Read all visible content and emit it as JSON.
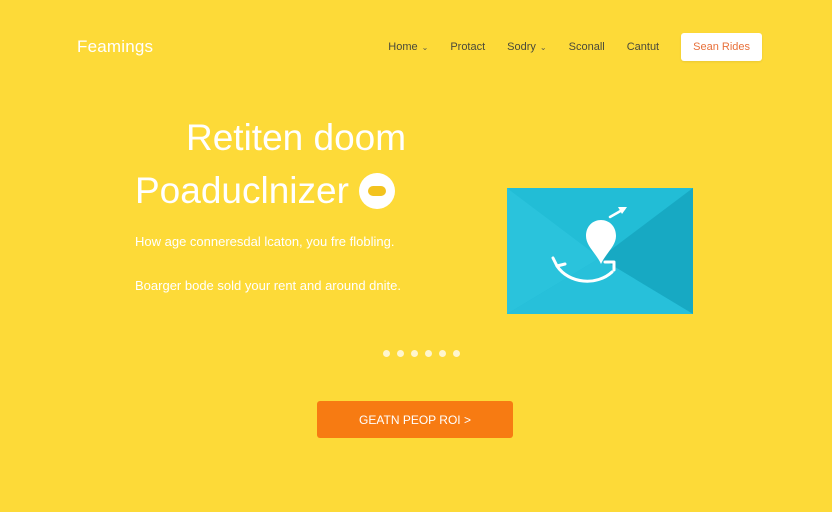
{
  "header": {
    "logo": "Feamings",
    "nav": [
      {
        "label": "Home",
        "dropdown": true
      },
      {
        "label": "Protact",
        "dropdown": false
      },
      {
        "label": "Sodry",
        "dropdown": true
      },
      {
        "label": "Sconall",
        "dropdown": false
      },
      {
        "label": "Cantut",
        "dropdown": false
      }
    ],
    "cta_label": "Sean Rides"
  },
  "hero": {
    "title_line_1": "Retiten doom",
    "title_line_2": "Poaduclnizer",
    "description_1": "How age conneresdal lcaton, you fre flobling.",
    "description_2": "Boarger bode sold your rent and around dnite.",
    "button_label": "GEATN PEOP ROI >"
  },
  "carousel": {
    "dot_count": 6,
    "active_index": 0
  },
  "colors": {
    "background": "#FDDA38",
    "accent_orange": "#F77B12",
    "illustration_teal": "#1EB6D0",
    "text_white": "#FFFFFF"
  },
  "icons": {
    "chevron": "chevron-down-icon",
    "illustration": "location-pin-illustration",
    "title_badge": "toggle-badge-icon"
  }
}
